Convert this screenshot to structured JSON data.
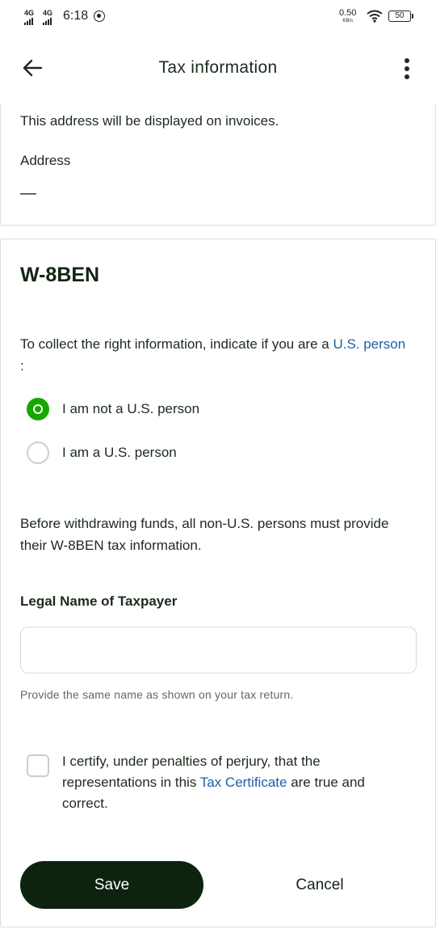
{
  "status_bar": {
    "network_1": "4G",
    "network_2": "4G",
    "time": "6:18",
    "net_speed": "0.50",
    "net_speed_unit": "KB/s",
    "battery": "50"
  },
  "header": {
    "title": "Tax information",
    "back_icon": "arrow-left-icon",
    "more_icon": "more-vertical-icon"
  },
  "address_section": {
    "description": "This address will be displayed on invoices.",
    "label": "Address",
    "value": "—"
  },
  "w8ben": {
    "title": "W-8BEN",
    "intro_text": "To collect the right information, indicate if you are a",
    "us_person_link": "U.S. person",
    "intro_suffix": " :",
    "options": [
      {
        "label": "I am not a U.S. person",
        "selected": true
      },
      {
        "label": "I am a U.S. person",
        "selected": false
      }
    ],
    "before_text": "Before withdrawing funds, all non-U.S. persons must provide their W-8BEN tax information.",
    "legal_name_label": "Legal Name of Taxpayer",
    "legal_name_value": "",
    "hint": "Provide the same name as shown on your tax return.",
    "certify_prefix": "I certify, under penalties of perjury, that the representations in this",
    "certify_link": "Tax Certificate",
    "certify_suffix": "are true and correct.",
    "certify_checked": false
  },
  "actions": {
    "save_label": "Save",
    "cancel_label": "Cancel"
  },
  "colors": {
    "accent_green": "#14a800",
    "link_blue": "#1f5fa8",
    "primary_button": "#0d2310"
  }
}
